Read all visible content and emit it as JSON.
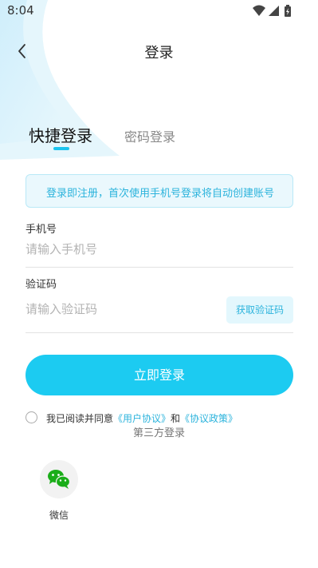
{
  "status_bar": {
    "time": "8:04",
    "icons": [
      "wifi-icon",
      "cellular-signal-icon",
      "battery-charging-icon"
    ]
  },
  "header": {
    "back_icon": "chevron-left-icon",
    "title": "登录"
  },
  "tabs": {
    "quick": "快捷登录",
    "password": "密码登录",
    "active": "quick"
  },
  "notice": "登录即注册，首次使用手机号登录将自动创建账号",
  "phone": {
    "label": "手机号",
    "placeholder": "请输入手机号",
    "value": ""
  },
  "code": {
    "label": "验证码",
    "placeholder": "请输入验证码",
    "value": "",
    "get_code_label": "获取验证码"
  },
  "login_button": "立即登录",
  "agreement": {
    "prefix": "我已阅读并同意",
    "user_link": "《用户协议》",
    "and": "和",
    "policy_link": "《协议政策》",
    "checked": false
  },
  "third_party": {
    "title": "第三方登录",
    "wechat_label": "微信",
    "wechat_icon": "wechat-icon"
  },
  "colors": {
    "accent": "#1ccbf1",
    "link": "#2bb3dc",
    "notice_bg": "#eaf8fd",
    "wechat_green": "#1aad19"
  }
}
